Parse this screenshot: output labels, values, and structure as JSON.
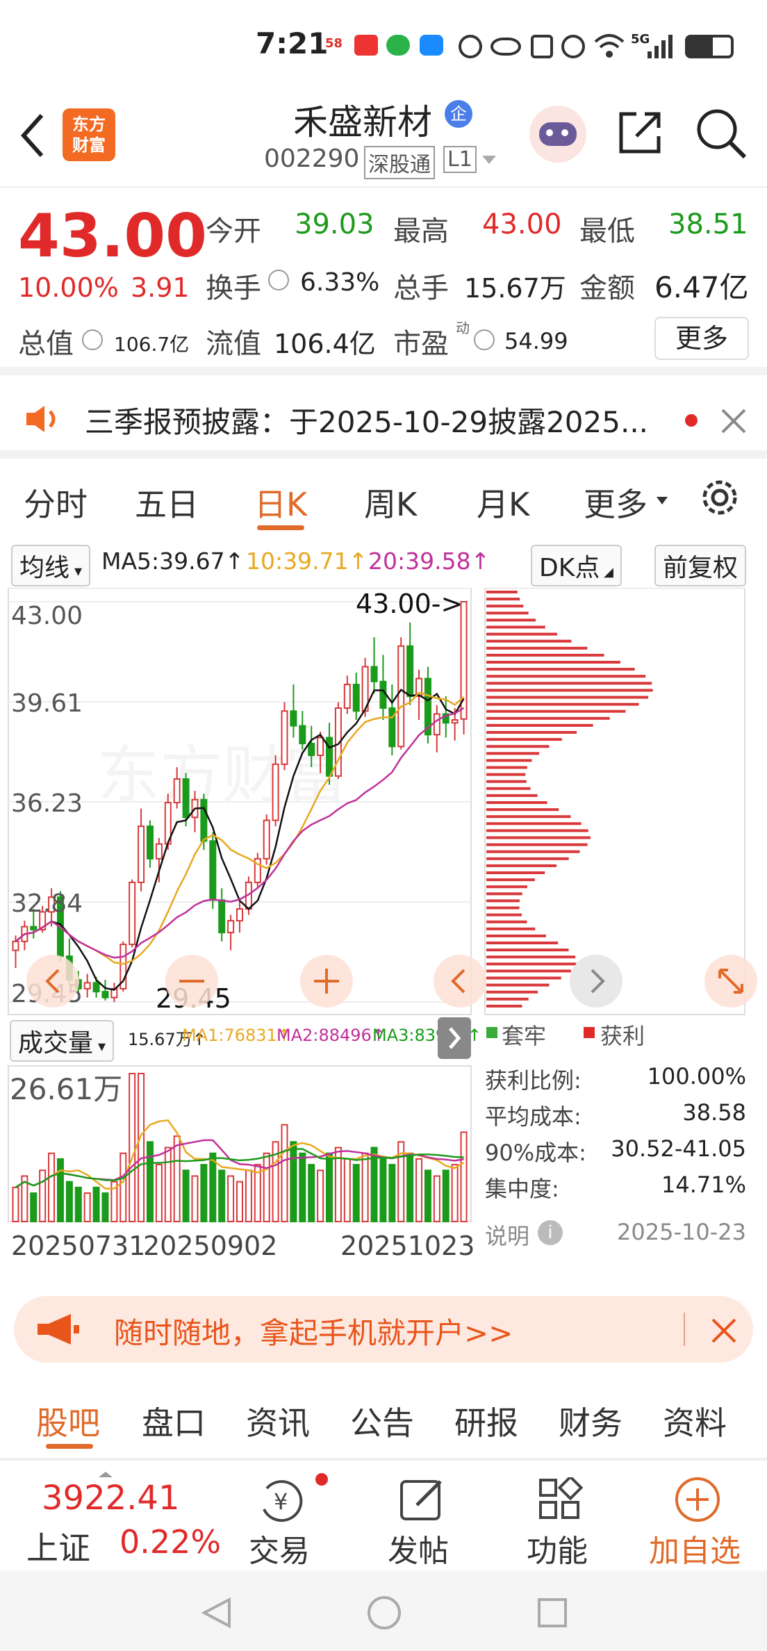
{
  "status": {
    "time": "7:21",
    "signal": "5G"
  },
  "header": {
    "logo_line1": "东方",
    "logo_line2": "财富",
    "stock_name": "禾盛新材",
    "badge": "企",
    "code": "002290",
    "market": "深股通",
    "level": "L1"
  },
  "quote": {
    "price": "43.00",
    "change_pct": "10.00%",
    "change": "3.91",
    "open_label": "今开",
    "open": "39.03",
    "high_label": "最高",
    "high": "43.00",
    "low_label": "最低",
    "low": "38.51",
    "turnover_label": "换手",
    "turnover": "6.33%",
    "volume_label": "总手",
    "volume": "15.67万",
    "amount_label": "金额",
    "amount": "6.47亿",
    "mktcap_label": "总值",
    "mktcap": "106.7亿",
    "float_label": "流值",
    "float": "106.4亿",
    "pe_label": "市盈",
    "pe_sup": "动",
    "pe": "54.99",
    "more": "更多"
  },
  "notice": {
    "text": "三季报预披露：于2025-10-29披露2025..."
  },
  "tabs": [
    "分时",
    "五日",
    "日K",
    "周K",
    "月K",
    "更多"
  ],
  "chart": {
    "ma_select": "均线",
    "ma5": "MA5:39.67↑",
    "ma10": "10:39.71↑",
    "ma20": "20:39.58↑",
    "dk": "DK点",
    "adjust": "前复权",
    "y_labels": [
      "43.00",
      "39.61",
      "36.23",
      "32.84",
      "29.45"
    ],
    "max_label": "43.00->",
    "min_label": "29.45",
    "vol_select": "成交量",
    "vol_stats": [
      "15.67万↑",
      "MA1:76831↑",
      "MA2:88496↑",
      "MA3:83958↑"
    ],
    "vol_max": "26.61万",
    "dates": [
      "20250731",
      "20250902",
      "20251023"
    ]
  },
  "chip": {
    "legend_trapped": "套牢",
    "legend_profit": "获利",
    "rows": [
      {
        "k": "获利比例:",
        "v": "100.00%"
      },
      {
        "k": "平均成本:",
        "v": "38.58"
      },
      {
        "k": "90%成本:",
        "v": "30.52-41.05"
      },
      {
        "k": "集中度:",
        "v": "14.71%"
      }
    ],
    "note": "说明",
    "date": "2025-10-23"
  },
  "banner": {
    "text": "随时随地，拿起手机就开户>>"
  },
  "subtabs": [
    "股吧",
    "盘口",
    "资讯",
    "公告",
    "研报",
    "财务",
    "资料"
  ],
  "bottom": {
    "index_value": "3922.41",
    "index_name": "上证",
    "index_pct": "0.22%",
    "trade": "交易",
    "post": "发帖",
    "func": "功能",
    "add": "加自选"
  },
  "candles": [
    [
      31.2,
      31.7,
      30.6,
      31.5
    ],
    [
      31.5,
      32.2,
      31.2,
      32.0
    ],
    [
      32.0,
      32.6,
      31.6,
      31.9
    ],
    [
      31.9,
      32.7,
      31.8,
      32.5
    ],
    [
      32.5,
      33.3,
      32.0,
      33.0
    ],
    [
      33.0,
      33.2,
      30.8,
      31.0
    ],
    [
      31.0,
      31.6,
      30.0,
      30.2
    ],
    [
      30.2,
      30.5,
      29.7,
      29.9
    ],
    [
      29.9,
      30.4,
      29.6,
      30.1
    ],
    [
      30.1,
      30.3,
      29.6,
      29.8
    ],
    [
      29.8,
      30.2,
      29.5,
      29.6
    ],
    [
      29.6,
      30.1,
      29.45,
      29.9
    ],
    [
      29.9,
      31.5,
      29.8,
      31.4
    ],
    [
      31.4,
      33.6,
      31.3,
      33.5
    ],
    [
      33.5,
      36.0,
      33.2,
      35.4
    ],
    [
      35.4,
      35.6,
      34.0,
      34.3
    ],
    [
      34.3,
      35.0,
      33.5,
      34.8
    ],
    [
      34.8,
      36.5,
      34.6,
      36.2
    ],
    [
      36.2,
      37.4,
      36.0,
      37.0
    ],
    [
      37.0,
      37.2,
      35.4,
      35.7
    ],
    [
      35.7,
      36.6,
      35.2,
      36.3
    ],
    [
      36.3,
      36.5,
      34.6,
      34.9
    ],
    [
      34.9,
      35.2,
      32.6,
      32.9
    ],
    [
      32.9,
      33.3,
      31.5,
      31.8
    ],
    [
      31.8,
      32.4,
      31.2,
      32.2
    ],
    [
      32.2,
      32.9,
      31.8,
      32.6
    ],
    [
      32.6,
      33.7,
      32.4,
      33.5
    ],
    [
      33.5,
      34.5,
      33.3,
      34.3
    ],
    [
      34.3,
      35.8,
      34.1,
      35.6
    ],
    [
      35.6,
      37.8,
      35.4,
      37.5
    ],
    [
      37.5,
      39.6,
      37.3,
      39.3
    ],
    [
      39.3,
      40.2,
      38.4,
      38.8
    ],
    [
      38.8,
      39.3,
      38.0,
      38.2
    ],
    [
      38.2,
      38.8,
      37.4,
      37.8
    ],
    [
      37.8,
      38.6,
      37.2,
      38.4
    ],
    [
      38.4,
      38.9,
      36.8,
      37.1
    ],
    [
      37.1,
      39.6,
      37.0,
      39.4
    ],
    [
      39.4,
      40.5,
      39.2,
      40.2
    ],
    [
      40.2,
      40.6,
      39.0,
      39.3
    ],
    [
      39.3,
      41.1,
      39.1,
      40.8
    ],
    [
      40.8,
      41.8,
      39.9,
      40.3
    ],
    [
      40.3,
      41.2,
      39.0,
      39.4
    ],
    [
      39.4,
      40.2,
      37.8,
      38.1
    ],
    [
      38.1,
      41.8,
      38.0,
      41.5
    ],
    [
      41.5,
      42.3,
      39.5,
      39.8
    ],
    [
      39.8,
      40.7,
      39.0,
      40.4
    ],
    [
      40.4,
      40.8,
      38.2,
      38.5
    ],
    [
      38.5,
      39.5,
      37.9,
      39.2
    ],
    [
      39.2,
      39.8,
      38.4,
      38.9
    ],
    [
      38.9,
      39.4,
      38.3,
      39.0
    ],
    [
      39.03,
      43.0,
      38.51,
      43.0
    ]
  ],
  "volumes": [
    0.06,
    0.08,
    0.05,
    0.09,
    0.12,
    0.11,
    0.07,
    0.06,
    0.05,
    0.06,
    0.05,
    0.07,
    0.12,
    0.26,
    0.26,
    0.14,
    0.1,
    0.13,
    0.15,
    0.09,
    0.08,
    0.1,
    0.12,
    0.09,
    0.08,
    0.07,
    0.09,
    0.1,
    0.12,
    0.14,
    0.17,
    0.14,
    0.12,
    0.1,
    0.09,
    0.12,
    0.13,
    0.11,
    0.1,
    0.12,
    0.13,
    0.11,
    0.1,
    0.14,
    0.12,
    0.11,
    0.09,
    0.08,
    0.09,
    0.1,
    0.157
  ]
}
